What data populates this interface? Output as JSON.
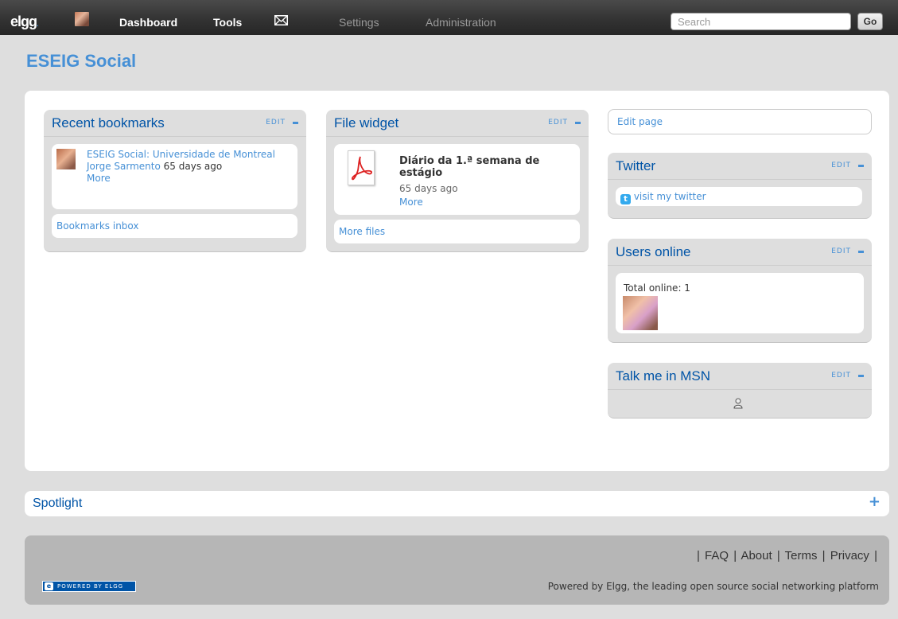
{
  "topbar": {
    "logo": "elgg",
    "logo_dot": ".",
    "nav": [
      "Dashboard",
      "Tools",
      "Settings",
      "Administration"
    ],
    "search_placeholder": "Search",
    "go_label": "Go"
  },
  "page_title": "ESEIG Social",
  "widgets": {
    "bookmarks": {
      "title": "Recent bookmarks",
      "edit": "EDIT",
      "item_title": "ESEIG Social: Universidade de Montreal",
      "item_author": "Jorge Sarmento",
      "item_time": "65 days ago",
      "item_more": "More",
      "footer_link": "Bookmarks inbox"
    },
    "files": {
      "title": "File widget",
      "edit": "EDIT",
      "item_title": "Diário da 1.ª semana de estágio",
      "item_time": "65 days ago",
      "item_more": "More",
      "footer_link": "More files"
    },
    "edit_page": "Edit page",
    "twitter": {
      "title": "Twitter",
      "edit": "EDIT",
      "link": "visit my twitter"
    },
    "users_online": {
      "title": "Users online",
      "edit": "EDIT",
      "total_label": "Total online: 1"
    },
    "msn": {
      "title": "Talk me in MSN",
      "edit": "EDIT"
    }
  },
  "spotlight": {
    "title": "Spotlight",
    "toggle": "+"
  },
  "footer": {
    "links": [
      "FAQ",
      "About",
      "Terms",
      "Privacy"
    ],
    "separator": "|",
    "tagline": "Powered by Elgg, the leading open source social networking platform",
    "badge": "POWERED BY ELGG",
    "badge_icon": "e"
  },
  "colors": {
    "accent": "#4690d6",
    "title_blue": "#0054a7",
    "topbar": "#333333",
    "page_bg": "#dedede",
    "footer_bg": "#b6b6b6"
  }
}
